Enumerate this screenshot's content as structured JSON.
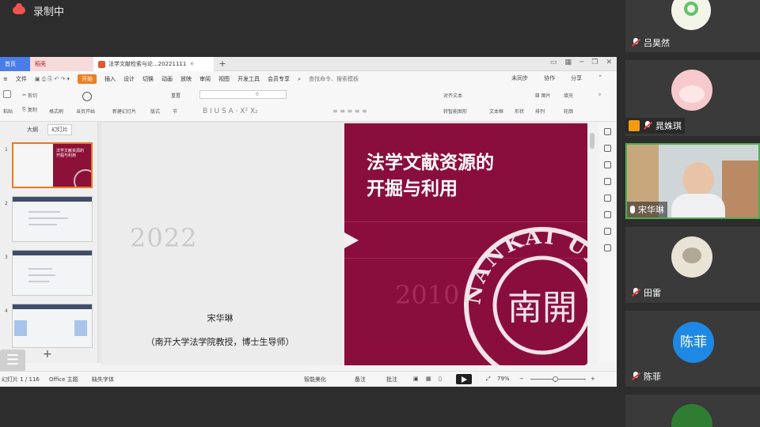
{
  "meeting": {
    "recording_label": "录制中"
  },
  "wps": {
    "tabs": {
      "home": "首页",
      "docer": "稻壳",
      "file": "法学文献检索与论...20221111"
    },
    "menu": {
      "file": "文件",
      "start": "开始",
      "insert": "插入",
      "design": "设计",
      "switch": "切换",
      "animation": "动画",
      "show": "放映",
      "review": "审阅",
      "view": "视图",
      "dev": "开发工具",
      "member": "会员专享",
      "search": "查找命令、搜索模板",
      "sync": "未同步",
      "collab": "协作",
      "share": "分享"
    },
    "ribbon": {
      "paste": "粘贴",
      "cut": "剪切",
      "copy": "复制",
      "format_painter": "格式刷",
      "from_current": "当页开始",
      "new_slide": "新建幻灯片",
      "layout": "版式",
      "section": "节",
      "reset": "重置",
      "font_size": "0",
      "text_box": "文本框",
      "shape": "形状",
      "picture": "图片",
      "arrange": "排列",
      "fill": "填充",
      "outline": "轮廓",
      "align_text": "对齐文本",
      "convert_smartart": "转智能图形"
    },
    "panel": {
      "outline_tab": "大纲",
      "slides_tab": "幻灯片",
      "slide_numbers": [
        "1",
        "2",
        "3",
        "4"
      ],
      "thumb1_title": "法学文献资源的开掘与利用"
    },
    "slide": {
      "year_left": "2022",
      "author": "宋华琳",
      "affiliation": "（南开大学法学院教授，博士生导师）",
      "title_line1": "法学文献资源的",
      "title_line2": "开掘与利用",
      "year_right": "2010",
      "seal_text": "NANKAI UNI",
      "seal_glyphs": "南開",
      "accent_color": "#8a0e3c"
    },
    "status": {
      "slide_count": "幻灯片 1 / 116",
      "theme": "Office 主题",
      "font_missing": "缺失字体",
      "smart_beautify": "智能美化",
      "notes": "备注",
      "comment": "批注",
      "zoom": "79%"
    }
  },
  "participants": [
    {
      "name": "吕昊然",
      "avatar": "green-cartoon"
    },
    {
      "name": "晁姝琪",
      "avatar": "pink-cartoon"
    },
    {
      "name": "宋华琳",
      "avatar": "video"
    },
    {
      "name": "田雷",
      "avatar": "ink-painting"
    },
    {
      "name": "陈菲",
      "avatar": "text",
      "avatar_text": "陈菲",
      "avatar_color": "#1e88e5"
    },
    {
      "name": "",
      "avatar": "green-circle"
    }
  ]
}
